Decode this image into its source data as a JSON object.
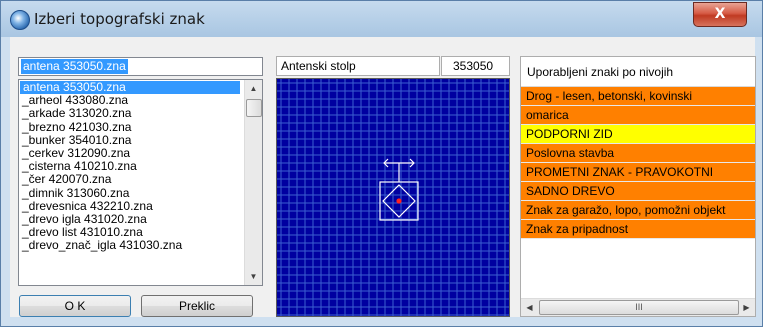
{
  "window": {
    "title": "Izberi topografski znak",
    "close_label": "X"
  },
  "selected_field": {
    "value": "antena 353050.zna"
  },
  "symbol_list": {
    "items": [
      "antena 353050.zna",
      "_arheol 433080.zna",
      "_arkade 313020.zna",
      "_brezno 421030.zna",
      "_bunker 354010.zna",
      "_cerkev 312090.zna",
      "_cisterna 410210.zna",
      "_čer 420070.zna",
      "_dimnik 313060.zna",
      "_drevesnica 432210.zna",
      "_drevo igla 431020.zna",
      "_drevo list 431010.zna",
      "_drevo_znač_igla 431030.zna"
    ],
    "selected_index": 0
  },
  "buttons": {
    "ok": "O K",
    "cancel": "Preklic"
  },
  "preview": {
    "name": "Antenski stolp",
    "code": "353050",
    "background": "#0000a0"
  },
  "used_panel": {
    "header": "Uporabljeni znaki po nivojih",
    "items": [
      {
        "label": "Drog - lesen, betonski, kovinski",
        "color": "#ff8000"
      },
      {
        "label": "omarica",
        "color": "#ff8000"
      },
      {
        "label": "PODPORNI ZID",
        "color": "#ffff00"
      },
      {
        "label": "Poslovna stavba",
        "color": "#ff8000"
      },
      {
        "label": "PROMETNI ZNAK - PRAVOKOTNI",
        "color": "#ff8000"
      },
      {
        "label": "SADNO DREVO",
        "color": "#ff8000"
      },
      {
        "label": "Znak za garažo, lopo, pomožni objekt",
        "color": "#ff8000"
      },
      {
        "label": "Znak za pripadnost",
        "color": "#ff8000"
      }
    ],
    "scroll_thumb_grip": "III"
  }
}
